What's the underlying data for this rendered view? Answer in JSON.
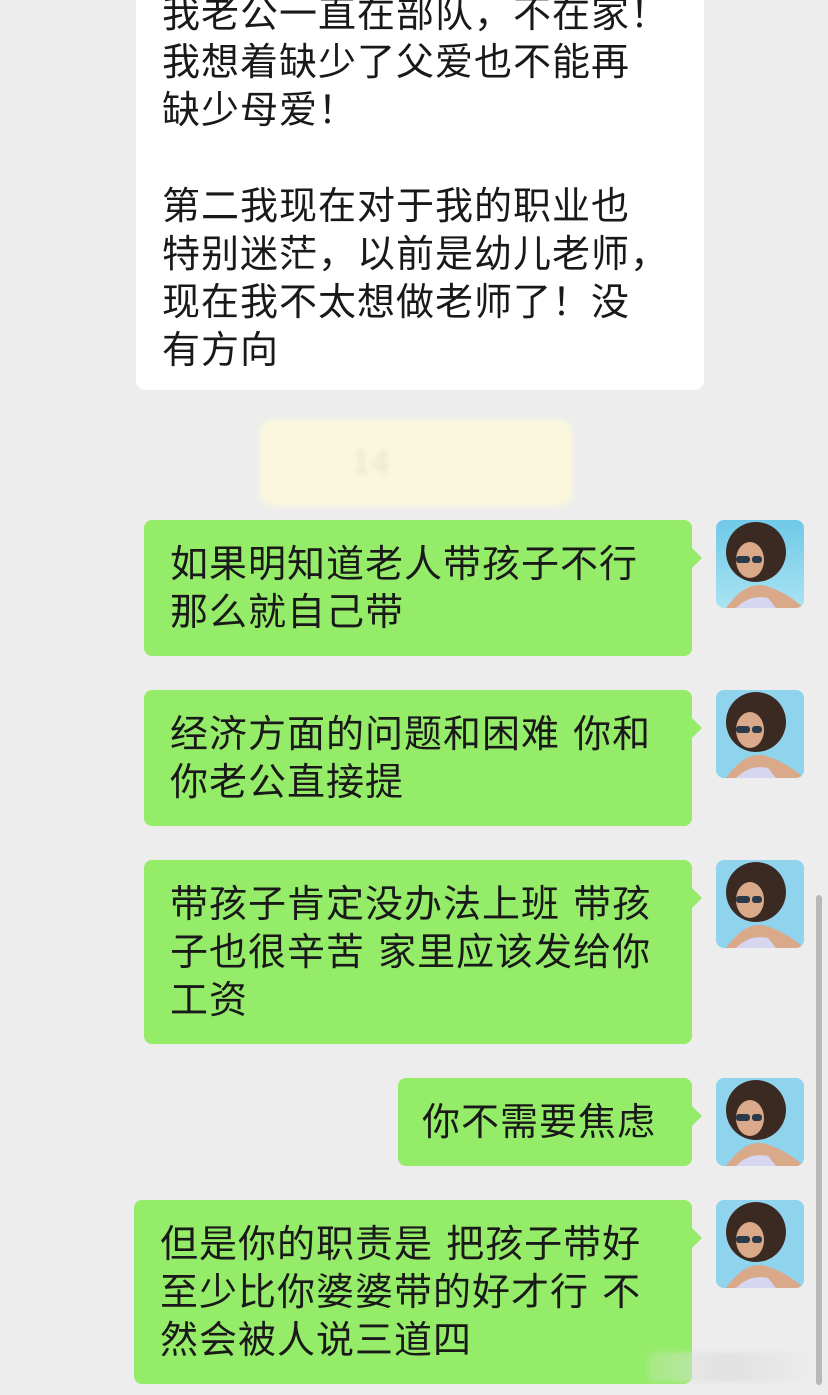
{
  "incoming": {
    "text": "我老公一直在部队，不在家！\n我想着缺少了父爱也不能再\n缺少母爱！\n\n第二我现在对于我的职业也\n特别迷茫，以前是幼儿老师，\n现在我不太想做老师了！没\n有方向"
  },
  "timestamp": {
    "text": "14"
  },
  "outgoing": [
    {
      "text": "如果明知道老人带孩子不行\n那么就自己带"
    },
    {
      "text": "经济方面的问题和困难 你和\n你老公直接提"
    },
    {
      "text": "带孩子肯定没办法上班 带孩\n子也很辛苦 家里应该发给你\n工资"
    },
    {
      "text": "你不需要焦虑"
    },
    {
      "text": "但是你的职责是 把孩子带好\n至少比你婆婆带的好才行 不\n然会被人说三道四"
    }
  ],
  "colors": {
    "background": "#ededed",
    "incoming_bubble": "#ffffff",
    "outgoing_bubble": "#95ec69"
  },
  "icons": {
    "avatar": "user-avatar-photo"
  }
}
